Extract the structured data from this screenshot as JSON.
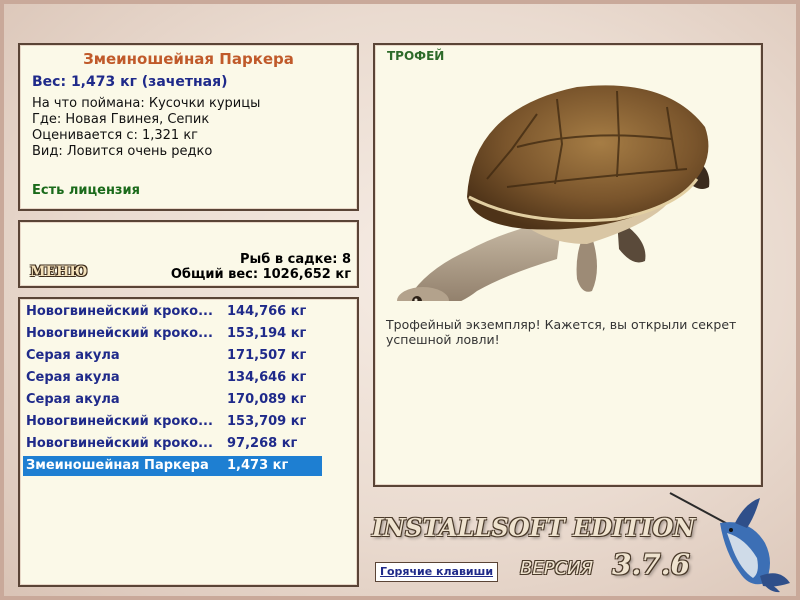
{
  "info": {
    "title": "Змеиношейная Паркера",
    "weight": "Вес: 1,473 кг (зачетная)",
    "lines": [
      "На что поймана: Кусочки курицы",
      "Где: Новая Гвинея, Сепик",
      "Оценивается с: 1,321 кг",
      "Вид: Ловится очень редко"
    ],
    "license": "Есть лицензия"
  },
  "stats": {
    "menu": "МЕНЮ",
    "fish_in_net": "Рыб в садке: 8",
    "total_weight": "Общий вес: 1026,652 кг"
  },
  "catch_list": [
    {
      "name": "Новогвинейский кроко...",
      "weight": "144,766 кг"
    },
    {
      "name": "Новогвинейский кроко...",
      "weight": "153,194 кг"
    },
    {
      "name": "Серая акула",
      "weight": "171,507 кг"
    },
    {
      "name": "Серая акула",
      "weight": "134,646 кг"
    },
    {
      "name": "Серая акула",
      "weight": "170,089 кг"
    },
    {
      "name": "Новогвинейский кроко...",
      "weight": "153,709 кг"
    },
    {
      "name": "Новогвинейский кроко...",
      "weight": "97,268 кг"
    },
    {
      "name": "Змеиношейная Паркера",
      "weight": "1,473 кг",
      "selected": true
    }
  ],
  "trophy": {
    "label": "ТРОФЕЙ",
    "description": "Трофейный экземпляр! Кажется, вы открыли секрет успешной ловли!"
  },
  "branding": {
    "edition": "INSTALLSOFT EDITION",
    "version_label": "ВЕРСИЯ",
    "version": "3.7.6"
  },
  "hotkeys": "Горячие клавиши",
  "colors": {
    "accent_selected": "#1e7fd2",
    "title": "#c05a2a",
    "list_text": "#1f2a8a",
    "license": "#1a6a1a"
  }
}
